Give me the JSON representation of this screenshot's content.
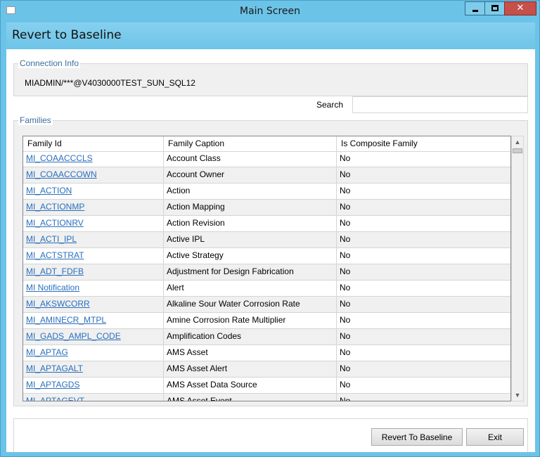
{
  "window": {
    "title": "Main Screen",
    "minimize_icon": "minimize-icon",
    "maximize_icon": "maximize-icon",
    "close_glyph": "✕"
  },
  "header": {
    "title": "Revert to Baseline"
  },
  "connection": {
    "legend": "Connection Info",
    "value": "MIADMIN/***@V4030000TEST_SUN_SQL12"
  },
  "search": {
    "label": "Search",
    "value": "",
    "placeholder": ""
  },
  "families": {
    "legend": "Families",
    "columns": [
      "Family Id",
      "Family Caption",
      "Is Composite Family"
    ],
    "rows": [
      [
        "MI_COAACCCLS",
        "Account Class",
        "No"
      ],
      [
        "MI_COAACCOWN",
        "Account Owner",
        "No"
      ],
      [
        "MI_ACTION",
        "Action",
        "No"
      ],
      [
        "MI_ACTIONMP",
        "Action Mapping",
        "No"
      ],
      [
        "MI_ACTIONRV",
        "Action Revision",
        "No"
      ],
      [
        "MI_ACTI_IPL",
        "Active IPL",
        "No"
      ],
      [
        "MI_ACTSTRAT",
        "Active Strategy",
        "No"
      ],
      [
        "MI_ADT_FDFB",
        "Adjustment for Design Fabrication",
        "No"
      ],
      [
        "MI Notification",
        "Alert",
        "No"
      ],
      [
        "MI_AKSWCORR",
        "Alkaline Sour Water Corrosion Rate",
        "No"
      ],
      [
        "MI_AMINECR_MTPL",
        "Amine Corrosion Rate Multiplier",
        "No"
      ],
      [
        "MI_GADS_AMPL_CODE",
        "Amplification Codes",
        "No"
      ],
      [
        "MI_APTAG",
        "AMS Asset",
        "No"
      ],
      [
        "MI_APTAGALT",
        "AMS Asset Alert",
        "No"
      ],
      [
        "MI_APTAGDS",
        "AMS Asset Data Source",
        "No"
      ],
      [
        "MI_APTAGEVT",
        "AMS Asset Event",
        "No"
      ]
    ]
  },
  "buttons": {
    "revert": "Revert To Baseline",
    "exit": "Exit"
  },
  "colors": {
    "titlebar": "#6cc3e8",
    "close": "#c7504a",
    "link": "#2a6fbd"
  }
}
